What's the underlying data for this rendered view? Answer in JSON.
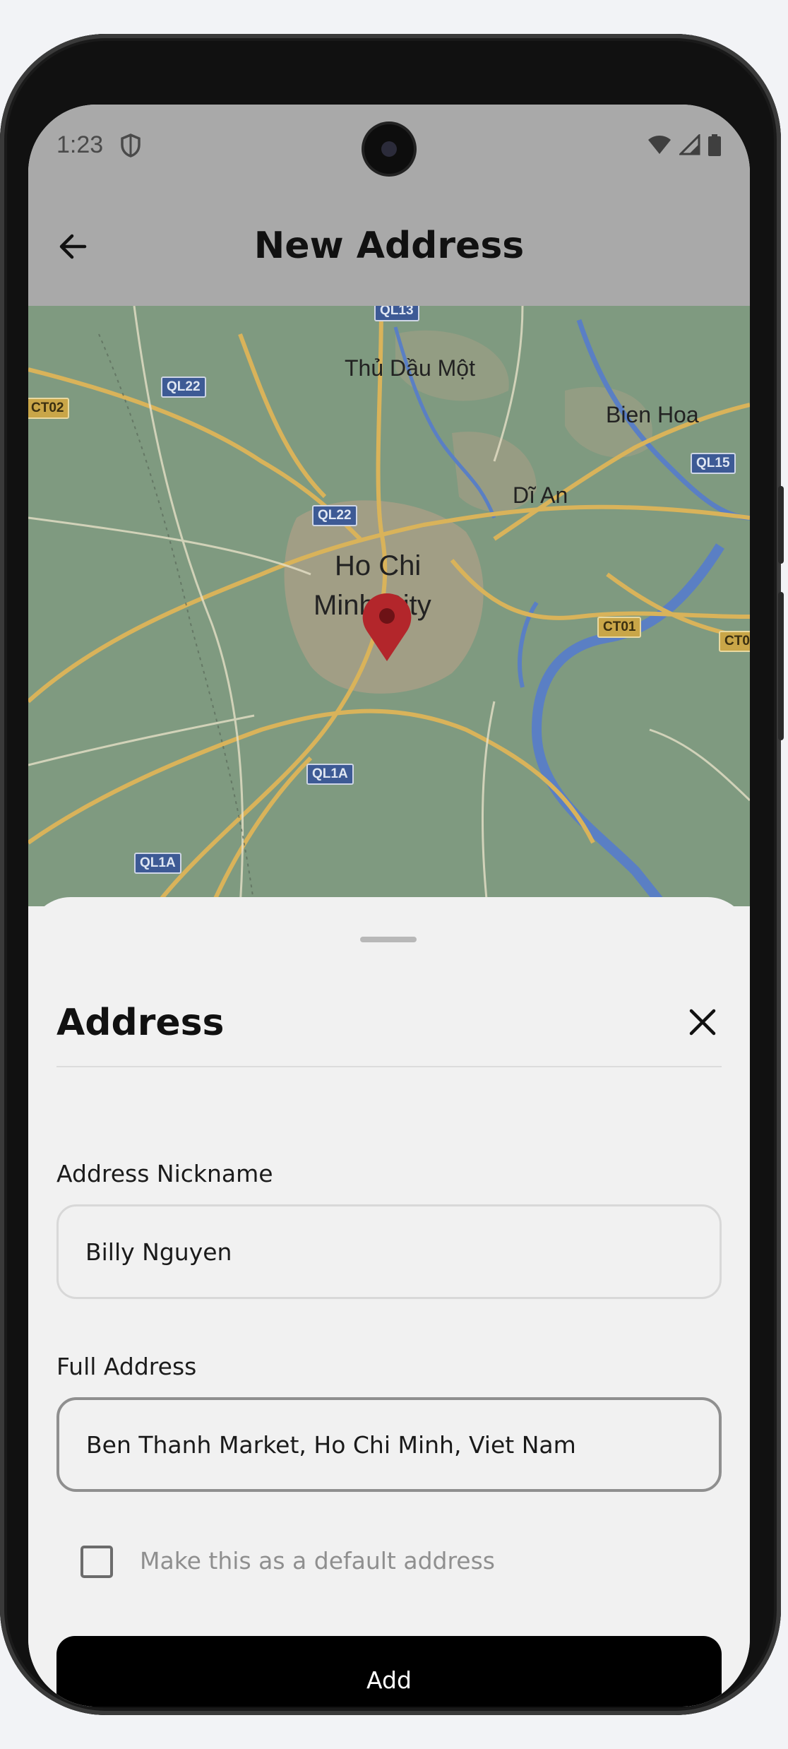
{
  "status": {
    "time": "1:23"
  },
  "header": {
    "title": "New Address"
  },
  "map": {
    "labels": {
      "thu_dau_mot": "Thủ Dầu Một",
      "bien_hoa": "Bien Hoa",
      "di_an": "Dĩ An",
      "city_line1": "Ho Chi",
      "city_line2": "Minh City"
    },
    "shields": {
      "ql13": "QL13",
      "ql22a": "QL22",
      "ql22b": "QL22",
      "ct02": "CT02",
      "ql15": "QL15",
      "ct01a": "CT01",
      "ct01b": "CT0",
      "ql1a_a": "QL1A",
      "ql1a_b": "QL1A"
    }
  },
  "sheet": {
    "title": "Address",
    "nickname_label": "Address Nickname",
    "nickname_value": "Billy Nguyen",
    "full_address_label": "Full Address",
    "full_address_value": "Ben Thanh Market, Ho Chi Minh, Viet Nam",
    "default_checkbox_label": "Make this as a default address",
    "default_checked": false,
    "add_button": "Add"
  },
  "colors": {
    "button_bg": "#000000",
    "overlay": "#a9a9a9",
    "pin": "#b3262b"
  }
}
